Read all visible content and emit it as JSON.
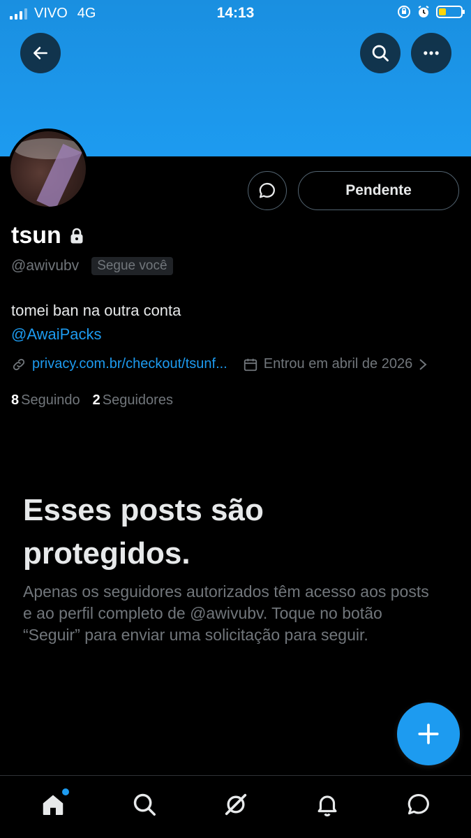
{
  "status_bar": {
    "carrier": "VIVO",
    "network": "4G",
    "time": "14:13"
  },
  "profile": {
    "display_name": "tsun",
    "handle": "@awivubv",
    "follows_you_badge": "Segue você",
    "bio_text": "tomei ban na outra conta",
    "bio_mention": "@AwaiPacks",
    "website": "privacy.com.br/checkout/tsunf...",
    "joined": "Entrou em abril de 2026",
    "following_count": "8",
    "following_label": "Seguindo",
    "followers_count": "2",
    "followers_label": "Seguidores"
  },
  "actions": {
    "pending_label": "Pendente"
  },
  "protected": {
    "title": "Esses posts são protegidos.",
    "description": "Apenas os seguidores autorizados têm acesso aos posts e ao perfil completo de @awivubv. Toque no botão “Seguir” para enviar uma solicitação para seguir."
  },
  "colors": {
    "accent": "#1d9bf0",
    "background": "#000000",
    "muted_text": "#71767b"
  },
  "icons": {
    "header": [
      "back-arrow-icon",
      "search-icon",
      "more-icon"
    ],
    "nav": [
      "home-icon",
      "search-icon",
      "grok-icon",
      "bell-icon",
      "messages-icon"
    ]
  }
}
